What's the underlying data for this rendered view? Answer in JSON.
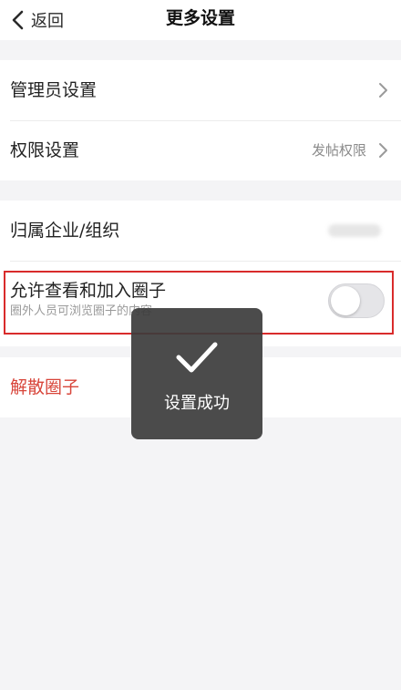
{
  "nav": {
    "back_label": "返回",
    "title": "更多设置"
  },
  "rows": {
    "admin_settings": "管理员设置",
    "permission_settings": "权限设置",
    "permission_value": "发帖权限",
    "org": "归属企业/组织",
    "allow_title": "允许查看和加入圈子",
    "allow_subtitle": "圈外人员可浏览圈子的内容",
    "allow_enabled": false,
    "dissolve": "解散圈子"
  },
  "toast": {
    "text": "设置成功"
  },
  "colors": {
    "danger": "#d8453a",
    "highlight_border": "#d92b2b",
    "toast_bg": "#3c3c3c"
  }
}
